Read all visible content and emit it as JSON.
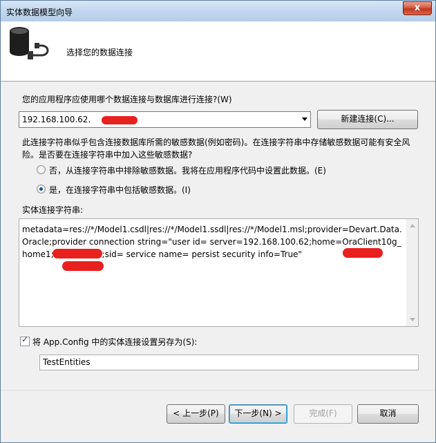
{
  "window": {
    "title": "实体数据模型向导",
    "close_glyph": "x"
  },
  "header": {
    "heading": "选择您的数据连接",
    "icon": "database-connect-icon"
  },
  "question": "您的应用程序应使用哪个数据连接与数据库进行连接?(W)",
  "connection": {
    "selected": "192.168.100.62.",
    "new_connection_label": "新建连接(C)..."
  },
  "warning_text": "此连接字符串似乎包含连接数据库所需的敏感数据(例如密码)。在连接字符串中存储敏感数据可能有安全风险。是否要在连接字符串中加入这些敏感数据?",
  "options": [
    {
      "label": "否，从连接字符串中排除敏感数据。我将在应用程序代码中设置此数据。(E)",
      "selected": false
    },
    {
      "label": "是，在连接字符串中包括敏感数据。(I)",
      "selected": true
    }
  ],
  "entity_conn": {
    "label": "实体连接字符串:",
    "value": "metadata=res://*/Model1.csdl|res://*/Model1.ssdl|res://*/Model1.msl;provider=Devart.Data.Oracle;provider connection string=\"user id=        server=192.168.100.62;home=OraClient10g_home1;direct=True;sid=          service name=           persist security info=True\""
  },
  "save_config": {
    "checked": true,
    "label": "将 App.Config 中的实体连接设置另存为(S):",
    "value": "TestEntities"
  },
  "buttons": {
    "back": "< 上一步(P)",
    "next": "下一步(N) >",
    "finish": "完成(F)",
    "cancel": "取消"
  },
  "colors": {
    "redaction": "#e8201e",
    "accent": "#3c7fb1"
  }
}
